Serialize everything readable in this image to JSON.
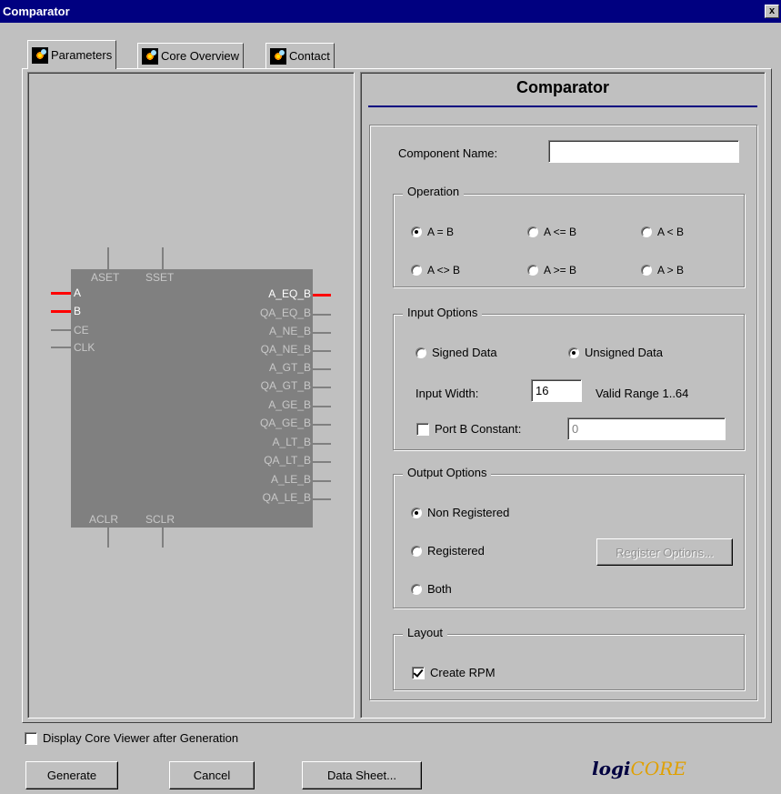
{
  "window": {
    "title": "Comparator",
    "close_glyph": "x"
  },
  "tabs": [
    {
      "label": "Parameters",
      "active": true,
      "icon": "core-gen-icon"
    },
    {
      "label": "Core Overview",
      "active": false,
      "icon": "core-gen-icon"
    },
    {
      "label": "Contact",
      "active": false,
      "icon": "core-gen-icon"
    }
  ],
  "symbol": {
    "top_pins": [
      "ASET",
      "SSET"
    ],
    "bottom_pins": [
      "ACLR",
      "SCLR"
    ],
    "left_pins": [
      "A",
      "B",
      "CE",
      "CLK"
    ],
    "right_pins": [
      "A_EQ_B",
      "QA_EQ_B",
      "A_NE_B",
      "QA_NE_B",
      "A_GT_B",
      "QA_GT_B",
      "A_GE_B",
      "QA_GE_B",
      "A_LT_B",
      "QA_LT_B",
      "A_LE_B",
      "QA_LE_B"
    ]
  },
  "panel": {
    "title": "Comparator",
    "component_name": {
      "label": "Component Name:",
      "value": ""
    },
    "operation": {
      "title": "Operation",
      "options": [
        "A = B",
        "A <= B",
        "A < B",
        "A <> B",
        "A >= B",
        "A > B"
      ],
      "selected": "A = B"
    },
    "input_options": {
      "title": "Input Options",
      "signed_label": "Signed Data",
      "unsigned_label": "Unsigned Data",
      "selected": "Unsigned Data",
      "width_label": "Input Width:",
      "width_value": "16",
      "range_label": "Valid Range 1..64",
      "port_b_label": "Port B Constant:",
      "port_b_checked": false,
      "port_b_value": "0"
    },
    "output_options": {
      "title": "Output Options",
      "non_registered": "Non Registered",
      "registered": "Registered",
      "both": "Both",
      "selected": "Non Registered",
      "register_options_btn": "Register Options..."
    },
    "layout": {
      "title": "Layout",
      "create_rpm_label": "Create RPM",
      "create_rpm_checked": true
    }
  },
  "footer": {
    "display_viewer_label": "Display Core Viewer after Generation",
    "display_viewer_checked": false,
    "generate": "Generate",
    "cancel": "Cancel",
    "data_sheet": "Data Sheet...",
    "logo_prefix": "logi",
    "logo_suffix": "CORE"
  }
}
